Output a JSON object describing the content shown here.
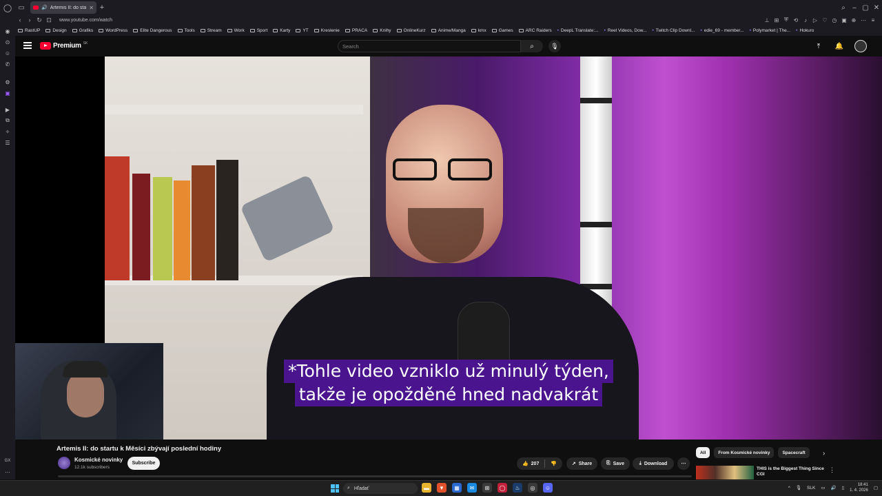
{
  "browser": {
    "tab_title": "Artemis II: do startu k",
    "url": "www.youtube.com/watch",
    "sidebar_label": "GX"
  },
  "bookmarks": [
    {
      "label": "RastUP",
      "icon": "folder-icon"
    },
    {
      "label": "Design",
      "icon": "folder-icon"
    },
    {
      "label": "Grafiks",
      "icon": "folder-icon"
    },
    {
      "label": "WordPress",
      "icon": "folder-icon"
    },
    {
      "label": "Elite Dangerous",
      "icon": "folder-icon"
    },
    {
      "label": "Tools",
      "icon": "folder-icon"
    },
    {
      "label": "Stream",
      "icon": "folder-icon"
    },
    {
      "label": "Work",
      "icon": "folder-icon"
    },
    {
      "label": "Sport",
      "icon": "folder-icon"
    },
    {
      "label": "Karty",
      "icon": "folder-icon"
    },
    {
      "label": "YT",
      "icon": "folder-icon"
    },
    {
      "label": "Kreslenie",
      "icon": "folder-icon"
    },
    {
      "label": "PRACA",
      "icon": "folder-icon"
    },
    {
      "label": "Knihy",
      "icon": "folder-icon"
    },
    {
      "label": "OnlineKurz",
      "icon": "folder-icon"
    },
    {
      "label": "Anime/Manga",
      "icon": "folder-icon"
    },
    {
      "label": "kmx",
      "icon": "folder-icon"
    },
    {
      "label": "Games",
      "icon": "folder-icon"
    },
    {
      "label": "ARC Raiders",
      "icon": "folder-icon"
    },
    {
      "label": "DeepL Translate:...",
      "icon": "deepl-icon"
    },
    {
      "label": "Reel Videos, Dow...",
      "icon": "link-icon"
    },
    {
      "label": "Twitch Clip Downl...",
      "icon": "twitch-icon"
    },
    {
      "label": "edie_69 - member...",
      "icon": "site-icon"
    },
    {
      "label": "Polymarket | The...",
      "icon": "site-icon"
    },
    {
      "label": "Hokuro",
      "icon": "site-icon"
    }
  ],
  "youtube": {
    "logo_text": "Premium",
    "logo_region": "SK",
    "search_placeholder": "Search"
  },
  "video": {
    "subtitle_line1": "*Tohle video vzniklo už minulý týden,",
    "subtitle_line2": "takže je opožděné hned nadvakrát",
    "title": "Artemis II: do startu k Měsíci zbývají poslední hodiny",
    "channel_name": "Kosmické novinky",
    "channel_subs": "12.1k subscribers",
    "subscribe_label": "Subscribe",
    "like_count": "207",
    "share_label": "Share",
    "save_label": "Save",
    "download_label": "Download"
  },
  "chips": [
    "All",
    "From Kosmické novinky",
    "Spacecraft"
  ],
  "recommendation": {
    "title": "THIS is the Biggest Thing Since CGI"
  },
  "taskbar": {
    "search_placeholder": "Hľadať",
    "language": "SLK",
    "time": "18:41",
    "date": "1. 4. 2026"
  }
}
